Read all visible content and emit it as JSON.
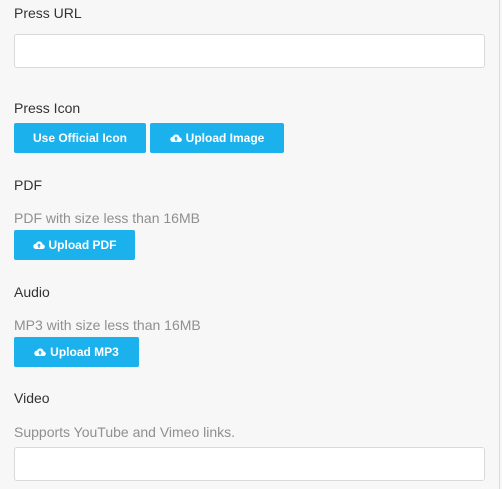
{
  "press_url": {
    "label": "Press URL",
    "value": "",
    "placeholder": ""
  },
  "press_icon": {
    "label": "Press Icon",
    "official_button": "Use Official Icon",
    "upload_button": "Upload Image",
    "upload_icon": "cloud-upload-icon"
  },
  "pdf": {
    "label": "PDF",
    "help": "PDF with size less than 16MB",
    "upload_button": "Upload PDF",
    "upload_icon": "cloud-upload-icon"
  },
  "audio": {
    "label": "Audio",
    "help": "MP3 with size less than 16MB",
    "upload_button": "Upload MP3",
    "upload_icon": "cloud-upload-icon"
  },
  "video": {
    "label": "Video",
    "help": "Supports YouTube and Vimeo links.",
    "value": "",
    "placeholder": ""
  },
  "colors": {
    "accent": "#1bb1ec",
    "background": "#f7f7f7",
    "label_text": "#333333",
    "help_text": "#8f8f8f"
  }
}
